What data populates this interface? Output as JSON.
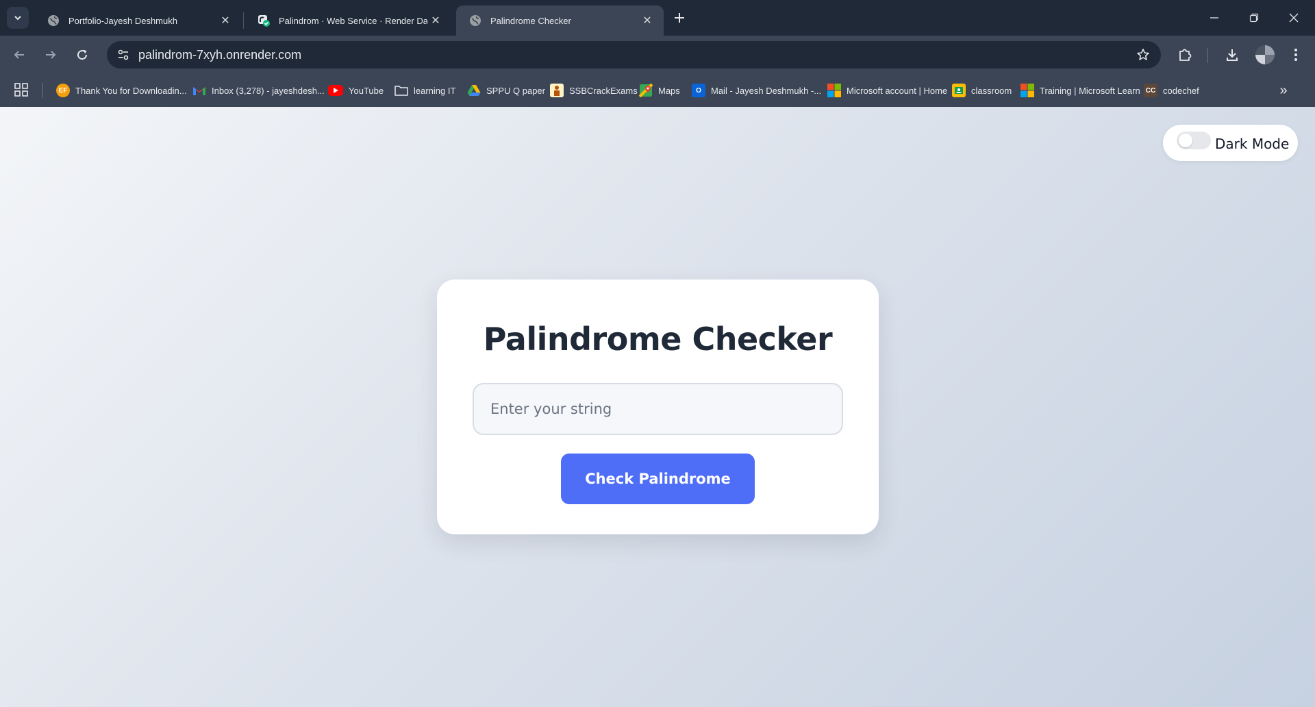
{
  "tabs": [
    {
      "title": "Portfolio-Jayesh Deshmukh",
      "icon": "globe-icon",
      "active": false
    },
    {
      "title": "Palindrom · Web Service · Render Dashboard",
      "icon": "render-icon",
      "active": false
    },
    {
      "title": "Palindrome Checker",
      "icon": "globe-icon",
      "active": true
    }
  ],
  "address_bar": {
    "url": "palindrom-7xyh.onrender.com"
  },
  "bookmarks": [
    {
      "label": "Thank You for Downloadin...",
      "icon": "ef-icon",
      "color": "#f59e0b"
    },
    {
      "label": "Inbox (3,278) - jayeshdesh...",
      "icon": "gmail-icon",
      "color": "#ea4335"
    },
    {
      "label": "YouTube",
      "icon": "youtube-icon",
      "color": "#ff0000"
    },
    {
      "label": "learning IT",
      "icon": "folder-icon",
      "color": "#e8eaed"
    },
    {
      "label": "SPPU Q paper",
      "icon": "drive-icon",
      "color": "#34a853"
    },
    {
      "label": "SSBCrackExams",
      "icon": "ssb-icon",
      "color": "#b45309"
    },
    {
      "label": "Maps",
      "icon": "maps-icon",
      "color": "#34a853"
    },
    {
      "label": "Mail - Jayesh Deshmukh -...",
      "icon": "outlook-icon",
      "color": "#0a64d8"
    },
    {
      "label": "Microsoft account | Home",
      "icon": "microsoft-icon",
      "color": "#f25022"
    },
    {
      "label": "classroom",
      "icon": "classroom-icon",
      "color": "#fbbc04"
    },
    {
      "label": "Training | Microsoft Learn",
      "icon": "microsoft-icon",
      "color": "#f25022"
    },
    {
      "label": "codechef",
      "icon": "codechef-icon",
      "color": "#5b4638"
    }
  ],
  "page": {
    "dark_mode_label": "Dark Mode",
    "dark_mode_on": false,
    "title": "Palindrome Checker",
    "input_placeholder": "Enter your string",
    "input_value": "",
    "check_button_label": "Check Palindrome",
    "accent_color": "#4f6ef7"
  }
}
